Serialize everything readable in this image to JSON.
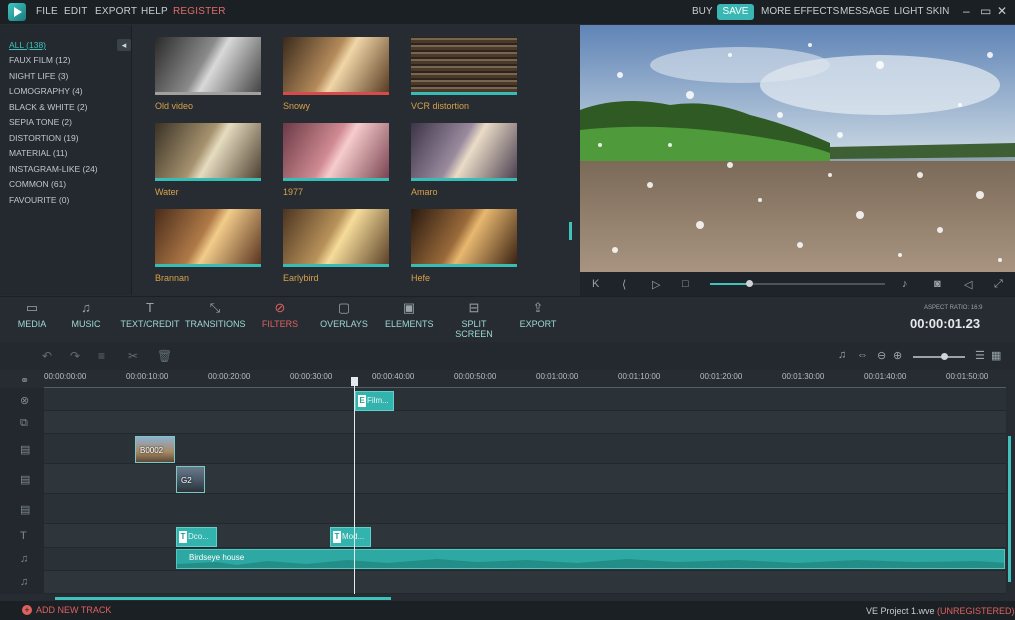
{
  "menu": {
    "items": [
      "FILE",
      "EDIT",
      "EXPORT",
      "HELP",
      "REGISTER"
    ],
    "right": {
      "buy": "BUY",
      "save": "SAVE",
      "more_effects": "MORE EFFECTS",
      "message": "MESSAGE",
      "light_skin": "LIGHT SKIN"
    }
  },
  "categories": [
    "ALL (138)",
    "FAUX FILM (12)",
    "NIGHT LIFE (3)",
    "LOMOGRAPHY (4)",
    "BLACK & WHITE (2)",
    "SEPIA TONE (2)",
    "DISTORTION (19)",
    "MATERIAL (11)",
    "INSTAGRAM-LIKE (24)",
    "COMMON (61)",
    "FAVOURITE (0)"
  ],
  "filters": [
    "Old video",
    "Snowy",
    "VCR distortion",
    "Water",
    "1977",
    "Amaro",
    "Brannan",
    "Earlybird",
    "Hefe"
  ],
  "tools": [
    "MEDIA",
    "MUSIC",
    "TEXT/CREDIT",
    "TRANSITIONS",
    "FILTERS",
    "OVERLAYS",
    "ELEMENTS",
    "SPLIT SCREEN",
    "EXPORT"
  ],
  "aspect_ratio": "ASPECT RATIO: 16:9",
  "timecode": "00:00:01.23",
  "ruler": [
    "00:00:00:00",
    "00:00:10:00",
    "00:00:20:00",
    "00:00:30:00",
    "00:00:40:00",
    "00:00:50:00",
    "00:01:00:00",
    "00:01:10:00",
    "00:01:20:00",
    "00:01:30:00",
    "00:01:40:00",
    "00:01:50:00"
  ],
  "clips": {
    "effect": "Film...",
    "video1": "B0002",
    "video2": "G2",
    "text1": "Dco...",
    "text2": "Mod...",
    "audio": "Birdseye house"
  },
  "player": {
    "seek_progress": 0.22
  },
  "zoom_level": 0.6,
  "footer": {
    "add_track": "ADD NEW TRACK",
    "project": "VE Project 1.wve",
    "unregistered": "(UNREGISTERED)"
  },
  "colors": {
    "accent": "#3fc1bc",
    "active": "#e0625f",
    "filter_label": "#d7a24a"
  }
}
